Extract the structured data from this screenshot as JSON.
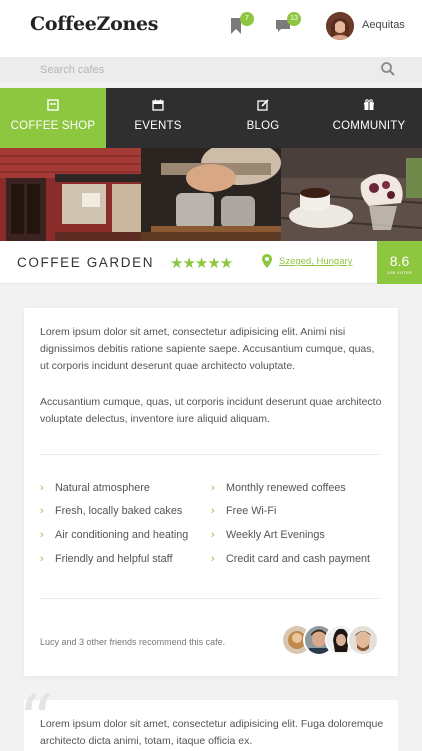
{
  "header": {
    "logo": "CoffeeZones",
    "bookmarks_count": "7",
    "messages_count": "13",
    "username": "Aequitas"
  },
  "search": {
    "placeholder": "Search cafes"
  },
  "nav": {
    "items": [
      {
        "label": "COFFEE SHOP",
        "icon": "shop-icon",
        "active": true
      },
      {
        "label": "EVENTS",
        "icon": "calendar-icon",
        "active": false
      },
      {
        "label": "BLOG",
        "icon": "edit-icon",
        "active": false
      },
      {
        "label": "COMMUNITY",
        "icon": "gift-icon",
        "active": false
      }
    ]
  },
  "shop": {
    "name": "COFFEE GARDEN",
    "rating_stars": 5,
    "stars": "★★★★★",
    "location": "Szeged, Hungary",
    "score": "8.6",
    "score_caption": "JOB VOTER"
  },
  "description": {
    "paragraph1": "Lorem ipsum dolor sit amet, consectetur adipisicing elit. Animi nisi dignissimos debitis ratione sapiente saepe. Accusantium cumque, quas, ut corporis incidunt deserunt quae architecto voluptate.",
    "paragraph2": "Accusantium cumque, quas, ut corporis incidunt deserunt quae architecto voluptate delectus, inventore iure aliquid aliquam."
  },
  "features": {
    "left": [
      "Natural atmosphere",
      "Fresh, locally baked cakes",
      "Air conditioning and heating",
      "Friendly and helpful staff"
    ],
    "right": [
      "Monthly renewed coffees",
      "Free Wi-Fi",
      "Weekly Art Evenings",
      "Credit card and cash payment"
    ]
  },
  "recommend": {
    "text": "Lucy and 3 other friends recommend this cafe."
  },
  "review": {
    "text": "Lorem ipsum dolor sit amet, consectetur adipisicing elit. Fuga doloremque architecto dicta animi, totam, itaque officia ex."
  },
  "colors": {
    "accent": "#8dc63f",
    "nav_bg": "#2f2f2f",
    "page_bg": "#f2f2f2"
  }
}
